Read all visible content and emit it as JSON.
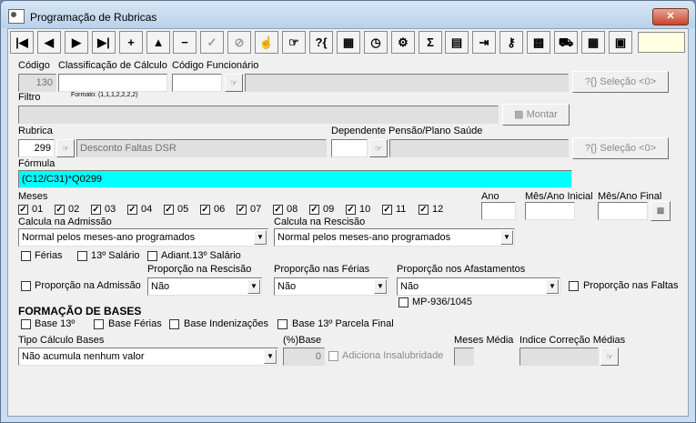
{
  "window": {
    "title": "Programação de Rubricas",
    "close_label": "✕"
  },
  "toolbar": [
    {
      "name": "first-record-button",
      "glyph": "|◀"
    },
    {
      "name": "prev-record-button",
      "glyph": "◀"
    },
    {
      "name": "next-record-button",
      "glyph": "▶"
    },
    {
      "name": "last-record-button",
      "glyph": "▶|"
    },
    {
      "name": "insert-button",
      "glyph": "+"
    },
    {
      "name": "edit-button",
      "glyph": "▲"
    },
    {
      "name": "delete-button",
      "glyph": "−"
    },
    {
      "name": "confirm-button",
      "glyph": "✓"
    },
    {
      "name": "cancel-button",
      "glyph": "⊘"
    },
    {
      "name": "hand-icon-button",
      "glyph": "☝"
    },
    {
      "name": "select-icon-button",
      "glyph": "☞"
    },
    {
      "name": "query-icon-button",
      "glyph": "?{"
    },
    {
      "name": "grid-icon-button",
      "glyph": "▦"
    },
    {
      "name": "clock-icon-button",
      "glyph": "◷"
    },
    {
      "name": "tools-icon-button",
      "glyph": "⚙"
    },
    {
      "name": "sum-button",
      "glyph": "Σ"
    },
    {
      "name": "report-icon-button",
      "glyph": "▤"
    },
    {
      "name": "export-icon-button",
      "glyph": "⇥"
    },
    {
      "name": "key-icon-button",
      "glyph": "⚷"
    },
    {
      "name": "search-icon-button",
      "glyph": "▩"
    },
    {
      "name": "truck-icon-button",
      "glyph": "⛟"
    },
    {
      "name": "calendar-icon-button",
      "glyph": "▦"
    },
    {
      "name": "window-icon-button",
      "glyph": "▣"
    }
  ],
  "labels": {
    "codigo": "Código",
    "classificacao": "Classificação de Cálculo",
    "codigo_funcionario": "Código Funcionário",
    "formato": "Formato: (1,1,1,2,2,2,2)",
    "filtro": "Filtro",
    "montar": "Montar",
    "rubrica": "Rubrica",
    "dependente": "Dependente Pensão/Plano Saúde",
    "formula": "Fórmula",
    "meses": "Meses",
    "ano": "Ano",
    "mes_ano_inicial": "Mês/Ano Inicial",
    "mes_ano_final": "Mês/Ano Final",
    "calcula_admissao": "Calcula na Admissão",
    "calcula_rescisao": "Calcula na Rescisão",
    "ferias": "Férias",
    "decimo_salario": "13º Salário",
    "adiant_decimo": "Adiant.13º Salário",
    "proporcao_admissao": "Proporção na Admissão",
    "proporcao_rescisao": "Proporção na Rescisão",
    "proporcao_ferias": "Proporção nas Férias",
    "proporcao_afastamentos": "Proporção nos Afastamentos",
    "proporcao_faltas": "Proporção nas Faltas",
    "mp": "MP-936/1045",
    "formacao_bases": "FORMAÇÃO DE BASES",
    "base_13": "Base 13º",
    "base_ferias": "Base Férias",
    "base_indenizacoes": "Base Indenizações",
    "base_13_parcela": "Base 13º Parcela Final",
    "tipo_calculo": "Tipo Cálculo Bases",
    "pct_base": "(%)Base",
    "adiciona_insalubridade": "Adiciona Insalubridade",
    "meses_media": "Meses Média",
    "indice_correcao": "Indice Correção Médias"
  },
  "buttons": {
    "selecao1": "Seleção <0>",
    "selecao2": "Seleção <0>"
  },
  "values": {
    "codigo": "130",
    "rubrica": "299",
    "rubrica_desc": "Desconto Faltas DSR",
    "formula": "(C12/C31)*Q0299",
    "calcula_admissao": "Normal pelos meses-ano programados",
    "calcula_rescisao": "Normal pelos meses-ano programados",
    "proporcao_rescisao": "Não",
    "proporcao_ferias": "Não",
    "proporcao_afastamentos": "Não",
    "tipo_calculo": "Não acumula nenhum valor",
    "pct_base": "0"
  },
  "months": [
    "01",
    "02",
    "03",
    "04",
    "05",
    "06",
    "07",
    "08",
    "09",
    "10",
    "11",
    "12"
  ],
  "check_mark": "✓",
  "colors": {
    "formula_bg": "#00ffff",
    "toolbar_fill": "#ffffe1"
  }
}
